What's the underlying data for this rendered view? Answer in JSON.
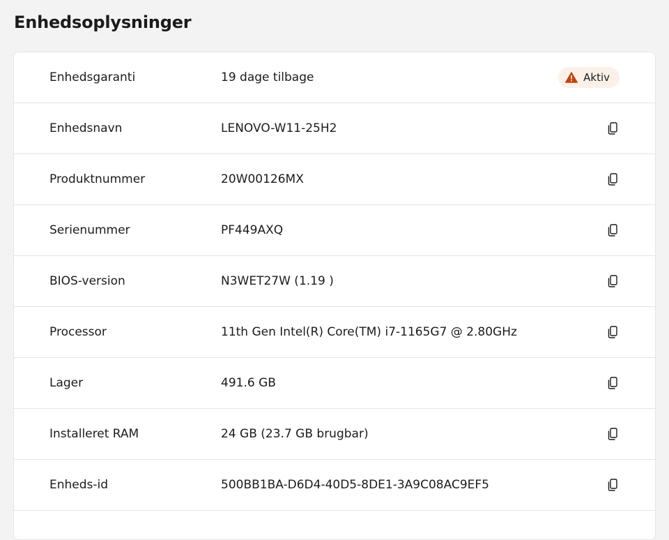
{
  "page_title": "Enhedsoplysninger",
  "rows": [
    {
      "label": "Enhedsgaranti",
      "value": "19 dage tilbage",
      "badge": "Aktiv"
    },
    {
      "label": "Enhedsnavn",
      "value": "LENOVO-W11-25H2"
    },
    {
      "label": "Produktnummer",
      "value": "20W00126MX"
    },
    {
      "label": "Serienummer",
      "value": "PF449AXQ"
    },
    {
      "label": "BIOS-version",
      "value": "N3WET27W (1.19 )"
    },
    {
      "label": "Processor",
      "value": "11th Gen Intel(R) Core(TM) i7-1165G7 @ 2.80GHz"
    },
    {
      "label": "Lager",
      "value": "491.6 GB"
    },
    {
      "label": "Installeret RAM",
      "value": "24 GB (23.7 GB brugbar)"
    },
    {
      "label": "Enheds-id",
      "value": "500BB1BA-D6D4-40D5-8DE1-3A9C08AC9EF5"
    }
  ],
  "icons": {
    "copy": "copy-icon",
    "warning": "warning-icon"
  },
  "colors": {
    "warning": "#c4410f",
    "badge_bg": "#fcf1e9",
    "divider": "#dfe6ea"
  }
}
